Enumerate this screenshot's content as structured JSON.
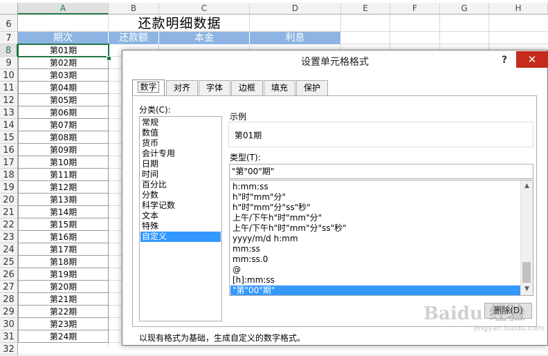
{
  "sheet": {
    "columns": [
      "A",
      "B",
      "C",
      "D",
      "E",
      "F",
      "G",
      "H"
    ],
    "rows": [
      "6",
      "7",
      "8",
      "9",
      "10",
      "11",
      "12",
      "13",
      "14",
      "15",
      "16",
      "17",
      "18",
      "19",
      "20",
      "21",
      "22",
      "23",
      "24",
      "25",
      "26",
      "27",
      "28",
      "29",
      "30",
      "31",
      "32"
    ],
    "title": "还款明细数据",
    "headers": [
      "期次",
      "还款额",
      "本金",
      "利息"
    ],
    "periods": [
      "第01期",
      "第02期",
      "第03期",
      "第04期",
      "第05期",
      "第06期",
      "第07期",
      "第08期",
      "第09期",
      "第10期",
      "第11期",
      "第12期",
      "第13期",
      "第14期",
      "第15期",
      "第16期",
      "第17期",
      "第18期",
      "第19期",
      "第20期",
      "第21期",
      "第22期",
      "第23期",
      "第24期"
    ]
  },
  "dialog": {
    "title": "设置单元格格式",
    "help": "?",
    "close": "✕",
    "tabs": [
      "数字",
      "对齐",
      "字体",
      "边框",
      "填充",
      "保护"
    ],
    "category_label": "分类(C):",
    "categories": [
      "常规",
      "数值",
      "货币",
      "会计专用",
      "日期",
      "时间",
      "百分比",
      "分数",
      "科学记数",
      "文本",
      "特殊",
      "自定义"
    ],
    "selected_category": "自定义",
    "sample_label": "示例",
    "sample_value": "第01期",
    "type_label": "类型(T):",
    "type_value": "\"第\"00\"期\"",
    "formats": [
      "h:mm:ss",
      "h\"时\"mm\"分\"",
      "h\"时\"mm\"分\"ss\"秒\"",
      "上午/下午h\"时\"mm\"分\"",
      "上午/下午h\"时\"mm\"分\"ss\"秒\"",
      "yyyy/m/d h:mm",
      "mm:ss",
      "mm:ss.0",
      "@",
      "[h]:mm:ss",
      "\"第\"00\"期\""
    ],
    "selected_format": "\"第\"00\"期\"",
    "delete_button": "删除(D)",
    "description": "以现有格式为基础，生成自定义的数字格式。"
  },
  "watermark": {
    "main": "Baidu 经验",
    "sub": "jingyan.baidu.com"
  }
}
